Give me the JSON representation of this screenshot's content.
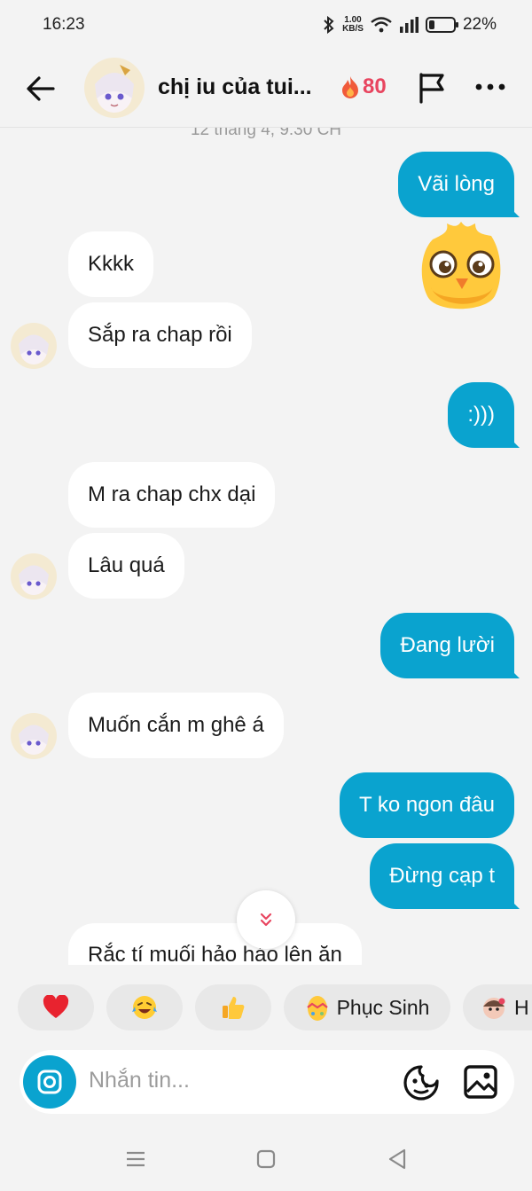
{
  "status": {
    "time": "16:23",
    "net_speed_value": "1.00",
    "net_speed_unit": "KB/S",
    "battery": "22%",
    "battery_level": 0.22
  },
  "header": {
    "title": "chị iu của tui...",
    "streak_count": "80"
  },
  "chat": {
    "timestamp": "12 tháng 4, 9:30 CH",
    "messages": [
      {
        "side": "out",
        "text": "Vãi lòng"
      },
      {
        "side": "in",
        "text": "Kkkk"
      },
      {
        "side": "in",
        "text": "Sắp ra chap rồi"
      },
      {
        "side": "out",
        "text": ":)))"
      },
      {
        "side": "in",
        "text": "M ra chap chx dại"
      },
      {
        "side": "in",
        "text": "Lâu quá"
      },
      {
        "side": "out",
        "text": "Đang lười"
      },
      {
        "side": "in",
        "text": "Muốn cắn m ghê á"
      },
      {
        "side": "out",
        "text": "T ko ngon đâu"
      },
      {
        "side": "out",
        "text": "Đừng cạp t"
      },
      {
        "side": "in",
        "text": "Rắc tí muối hảo hảo lên ăn"
      }
    ]
  },
  "quick_reactions": [
    {
      "icon": "heart-icon",
      "label": ""
    },
    {
      "icon": "laughing-emoji-icon",
      "label": ""
    },
    {
      "icon": "thumbs-up-icon",
      "label": ""
    },
    {
      "icon": "easter-egg-icon",
      "label": "Phục Sinh"
    },
    {
      "icon": "sticker-face-icon",
      "label": "H"
    }
  ],
  "composer": {
    "placeholder": "Nhắn tin..."
  },
  "colors": {
    "accent": "#0aa3cf",
    "incoming_bubble": "#ffffff",
    "background": "#f3f3f3",
    "streak": "#e8455f"
  }
}
